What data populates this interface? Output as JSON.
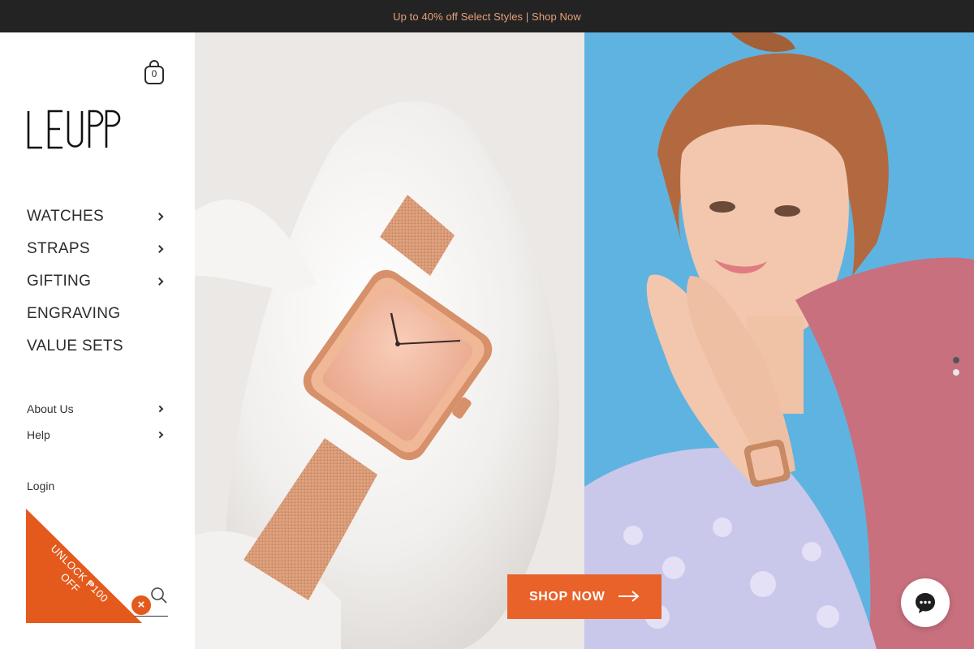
{
  "announcement": {
    "text": "Up to 40% off Select Styles | Shop Now"
  },
  "cart": {
    "count": "0",
    "icon": "shopping-bag-icon"
  },
  "brand": {
    "logo_text": "LEUPP"
  },
  "main_nav": [
    {
      "label": "WATCHES",
      "has_submenu": true
    },
    {
      "label": "STRAPS",
      "has_submenu": true
    },
    {
      "label": "GIFTING",
      "has_submenu": true
    },
    {
      "label": "ENGRAVING",
      "has_submenu": false
    },
    {
      "label": "VALUE SETS",
      "has_submenu": false
    }
  ],
  "secondary_nav": [
    {
      "label": "About Us",
      "has_submenu": true
    },
    {
      "label": "Help",
      "has_submenu": true
    }
  ],
  "account": {
    "login_label": "Login"
  },
  "search": {
    "icon": "search-icon"
  },
  "promo": {
    "text": "UNLOCK ₱100 OFF",
    "color": "#e35a1c",
    "close_icon": "close-icon"
  },
  "hero": {
    "button_label": "SHOP NOW",
    "button_color": "#e8622a",
    "slides": 2,
    "active_slide": 1
  },
  "chat": {
    "icon": "chat-icon"
  }
}
